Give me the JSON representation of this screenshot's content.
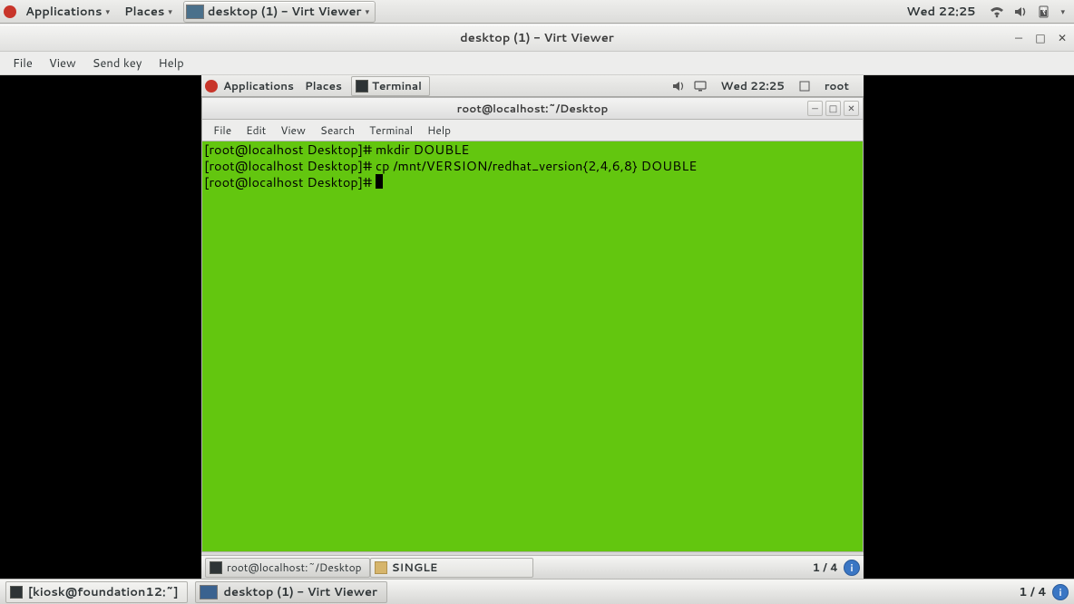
{
  "outer_topbar": {
    "applications": "Applications",
    "places": "Places",
    "active_window": "desktop (1) - Virt Viewer",
    "clock": "Wed 22:25"
  },
  "virt_viewer": {
    "title": "desktop (1) - Virt Viewer",
    "menus": {
      "file": "File",
      "view": "View",
      "sendkey": "Send key",
      "help": "Help"
    }
  },
  "inner_topbar": {
    "applications": "Applications",
    "places": "Places",
    "active_app": "Terminal",
    "clock": "Wed 22:25",
    "user": "root"
  },
  "terminal": {
    "title": "root@localhost:~/Desktop",
    "menus": {
      "file": "File",
      "edit": "Edit",
      "view": "View",
      "search": "Search",
      "terminal": "Terminal",
      "help": "Help"
    },
    "lines": [
      "[root@localhost Desktop]# mkdir DOUBLE",
      "[root@localhost Desktop]# cp /mnt/VERSION/redhat_version{2,4,6,8} DOUBLE",
      "[root@localhost Desktop]# "
    ]
  },
  "inner_bottombar": {
    "task_terminal": "root@localhost:~/Desktop",
    "task_files": "SINGLE",
    "workspace": "1 / 4",
    "badge": "i"
  },
  "outer_bottombar": {
    "task_kiosk": "[kiosk@foundation12:~]",
    "task_virt": "desktop (1) - Virt Viewer",
    "workspace": "1 / 4",
    "badge": "i"
  }
}
